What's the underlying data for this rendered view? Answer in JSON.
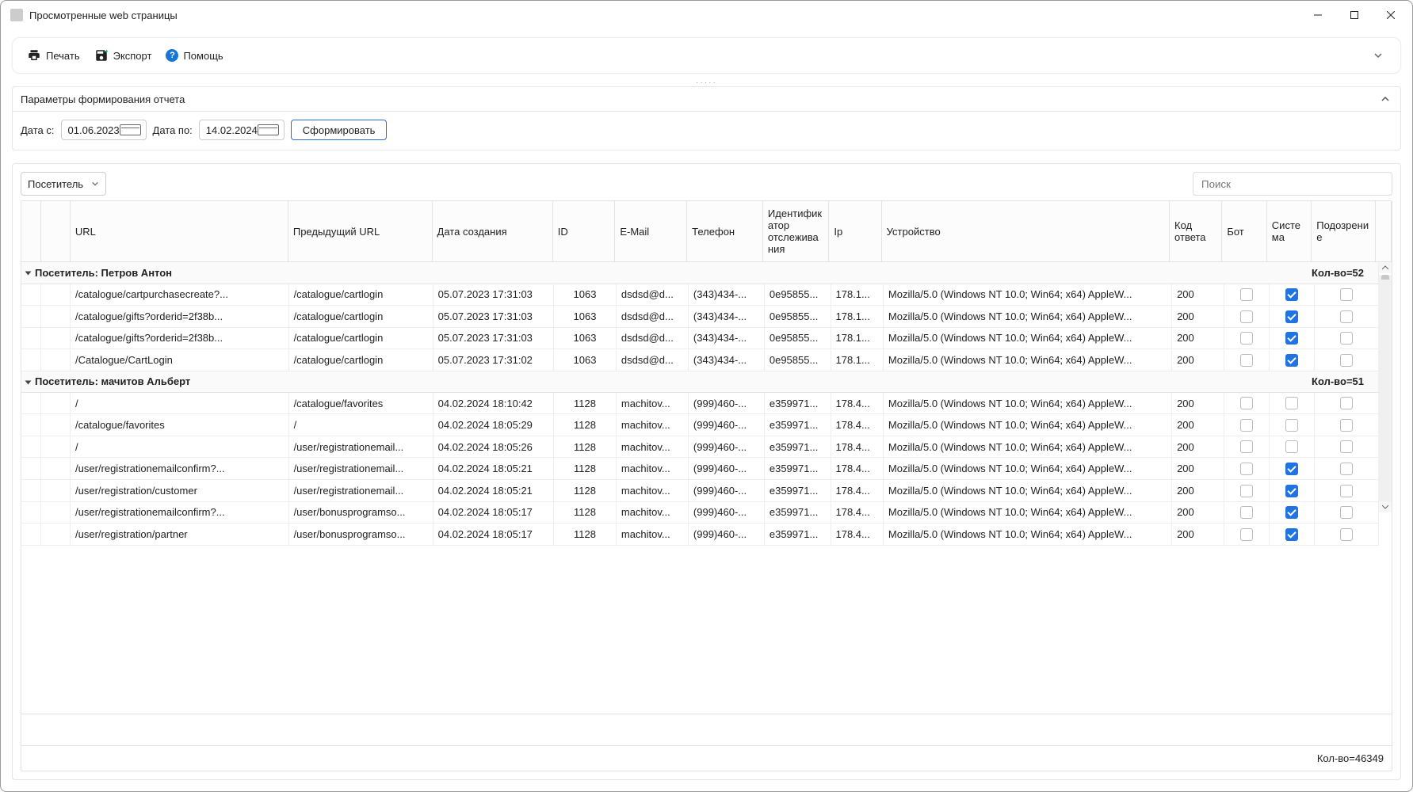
{
  "window": {
    "title": "Просмотренные web страницы"
  },
  "toolbar": {
    "print": "Печать",
    "export": "Экспорт",
    "help": "Помощь"
  },
  "params": {
    "panel_title": "Параметры формирования отчета",
    "date_from_label": "Дата с:",
    "date_from_value": "01.06.2023",
    "date_to_label": "Дата по:",
    "date_to_value": "14.02.2024",
    "generate_label": "Сформировать"
  },
  "grid": {
    "group_by_value": "Посетитель",
    "search_placeholder": "Поиск",
    "columns": {
      "url": "URL",
      "prev_url": "Предыдущий URL",
      "created": "Дата создания",
      "id": "ID",
      "email": "E-Mail",
      "phone": "Телефон",
      "tracking": "Идентификатор отслеживания",
      "ip": "Ip",
      "device": "Устройство",
      "code": "Код ответа",
      "bot": "Бот",
      "system": "Система",
      "suspicion": "Подозрение"
    },
    "groups": [
      {
        "label": "Посетитель: Петров Антон",
        "count_label": "Кол-во=52",
        "rows": [
          {
            "url": "/catalogue/cartpurchasecreate?...",
            "prev": "/catalogue/cartlogin",
            "date": "05.07.2023 17:31:03",
            "id": "1063",
            "email": "dsdsd@d...",
            "phone": "(343)434-...",
            "track": "0e95855...",
            "ip": "178.1...",
            "device": "Mozilla/5.0 (Windows NT 10.0; Win64; x64) AppleW...",
            "code": "200",
            "bot": false,
            "sys": true,
            "susp": false
          },
          {
            "url": "/catalogue/gifts?orderid=2f38b...",
            "prev": "/catalogue/cartlogin",
            "date": "05.07.2023 17:31:03",
            "id": "1063",
            "email": "dsdsd@d...",
            "phone": "(343)434-...",
            "track": "0e95855...",
            "ip": "178.1...",
            "device": "Mozilla/5.0 (Windows NT 10.0; Win64; x64) AppleW...",
            "code": "200",
            "bot": false,
            "sys": true,
            "susp": false
          },
          {
            "url": "/catalogue/gifts?orderid=2f38b...",
            "prev": "/catalogue/cartlogin",
            "date": "05.07.2023 17:31:03",
            "id": "1063",
            "email": "dsdsd@d...",
            "phone": "(343)434-...",
            "track": "0e95855...",
            "ip": "178.1...",
            "device": "Mozilla/5.0 (Windows NT 10.0; Win64; x64) AppleW...",
            "code": "200",
            "bot": false,
            "sys": true,
            "susp": false
          },
          {
            "url": "/Catalogue/CartLogin",
            "prev": "/catalogue/cartlogin",
            "date": "05.07.2023 17:31:02",
            "id": "1063",
            "email": "dsdsd@d...",
            "phone": "(343)434-...",
            "track": "0e95855...",
            "ip": "178.1...",
            "device": "Mozilla/5.0 (Windows NT 10.0; Win64; x64) AppleW...",
            "code": "200",
            "bot": false,
            "sys": true,
            "susp": false
          }
        ]
      },
      {
        "label": "Посетитель: мачитов Альберт",
        "count_label": "Кол-во=51",
        "rows": [
          {
            "url": "/",
            "prev": "/catalogue/favorites",
            "date": "04.02.2024 18:10:42",
            "id": "1128",
            "email": "machitov...",
            "phone": "(999)460-...",
            "track": "e359971...",
            "ip": "178.4...",
            "device": "Mozilla/5.0 (Windows NT 10.0; Win64; x64) AppleW...",
            "code": "200",
            "bot": false,
            "sys": false,
            "susp": false
          },
          {
            "url": "/catalogue/favorites",
            "prev": "/",
            "date": "04.02.2024 18:05:29",
            "id": "1128",
            "email": "machitov...",
            "phone": "(999)460-...",
            "track": "e359971...",
            "ip": "178.4...",
            "device": "Mozilla/5.0 (Windows NT 10.0; Win64; x64) AppleW...",
            "code": "200",
            "bot": false,
            "sys": false,
            "susp": false
          },
          {
            "url": "/",
            "prev": "/user/registrationemail...",
            "date": "04.02.2024 18:05:26",
            "id": "1128",
            "email": "machitov...",
            "phone": "(999)460-...",
            "track": "e359971...",
            "ip": "178.4...",
            "device": "Mozilla/5.0 (Windows NT 10.0; Win64; x64) AppleW...",
            "code": "200",
            "bot": false,
            "sys": false,
            "susp": false
          },
          {
            "url": "/user/registrationemailconfirm?...",
            "prev": "/user/registrationemail...",
            "date": "04.02.2024 18:05:21",
            "id": "1128",
            "email": "machitov...",
            "phone": "(999)460-...",
            "track": "e359971...",
            "ip": "178.4...",
            "device": "Mozilla/5.0 (Windows NT 10.0; Win64; x64) AppleW...",
            "code": "200",
            "bot": false,
            "sys": true,
            "susp": false
          },
          {
            "url": "/user/registration/customer",
            "prev": "/user/registrationemail...",
            "date": "04.02.2024 18:05:21",
            "id": "1128",
            "email": "machitov...",
            "phone": "(999)460-...",
            "track": "e359971...",
            "ip": "178.4...",
            "device": "Mozilla/5.0 (Windows NT 10.0; Win64; x64) AppleW...",
            "code": "200",
            "bot": false,
            "sys": true,
            "susp": false
          },
          {
            "url": "/user/registrationemailconfirm?...",
            "prev": "/user/bonusprogramso...",
            "date": "04.02.2024 18:05:17",
            "id": "1128",
            "email": "machitov...",
            "phone": "(999)460-...",
            "track": "e359971...",
            "ip": "178.4...",
            "device": "Mozilla/5.0 (Windows NT 10.0; Win64; x64) AppleW...",
            "code": "200",
            "bot": false,
            "sys": true,
            "susp": false
          },
          {
            "url": "/user/registration/partner",
            "prev": "/user/bonusprogramso...",
            "date": "04.02.2024 18:05:17",
            "id": "1128",
            "email": "machitov...",
            "phone": "(999)460-...",
            "track": "e359971...",
            "ip": "178.4...",
            "device": "Mozilla/5.0 (Windows NT 10.0; Win64; x64) AppleW...",
            "code": "200",
            "bot": false,
            "sys": true,
            "susp": false
          }
        ]
      }
    ],
    "total_label": "Кол-во=46349"
  }
}
